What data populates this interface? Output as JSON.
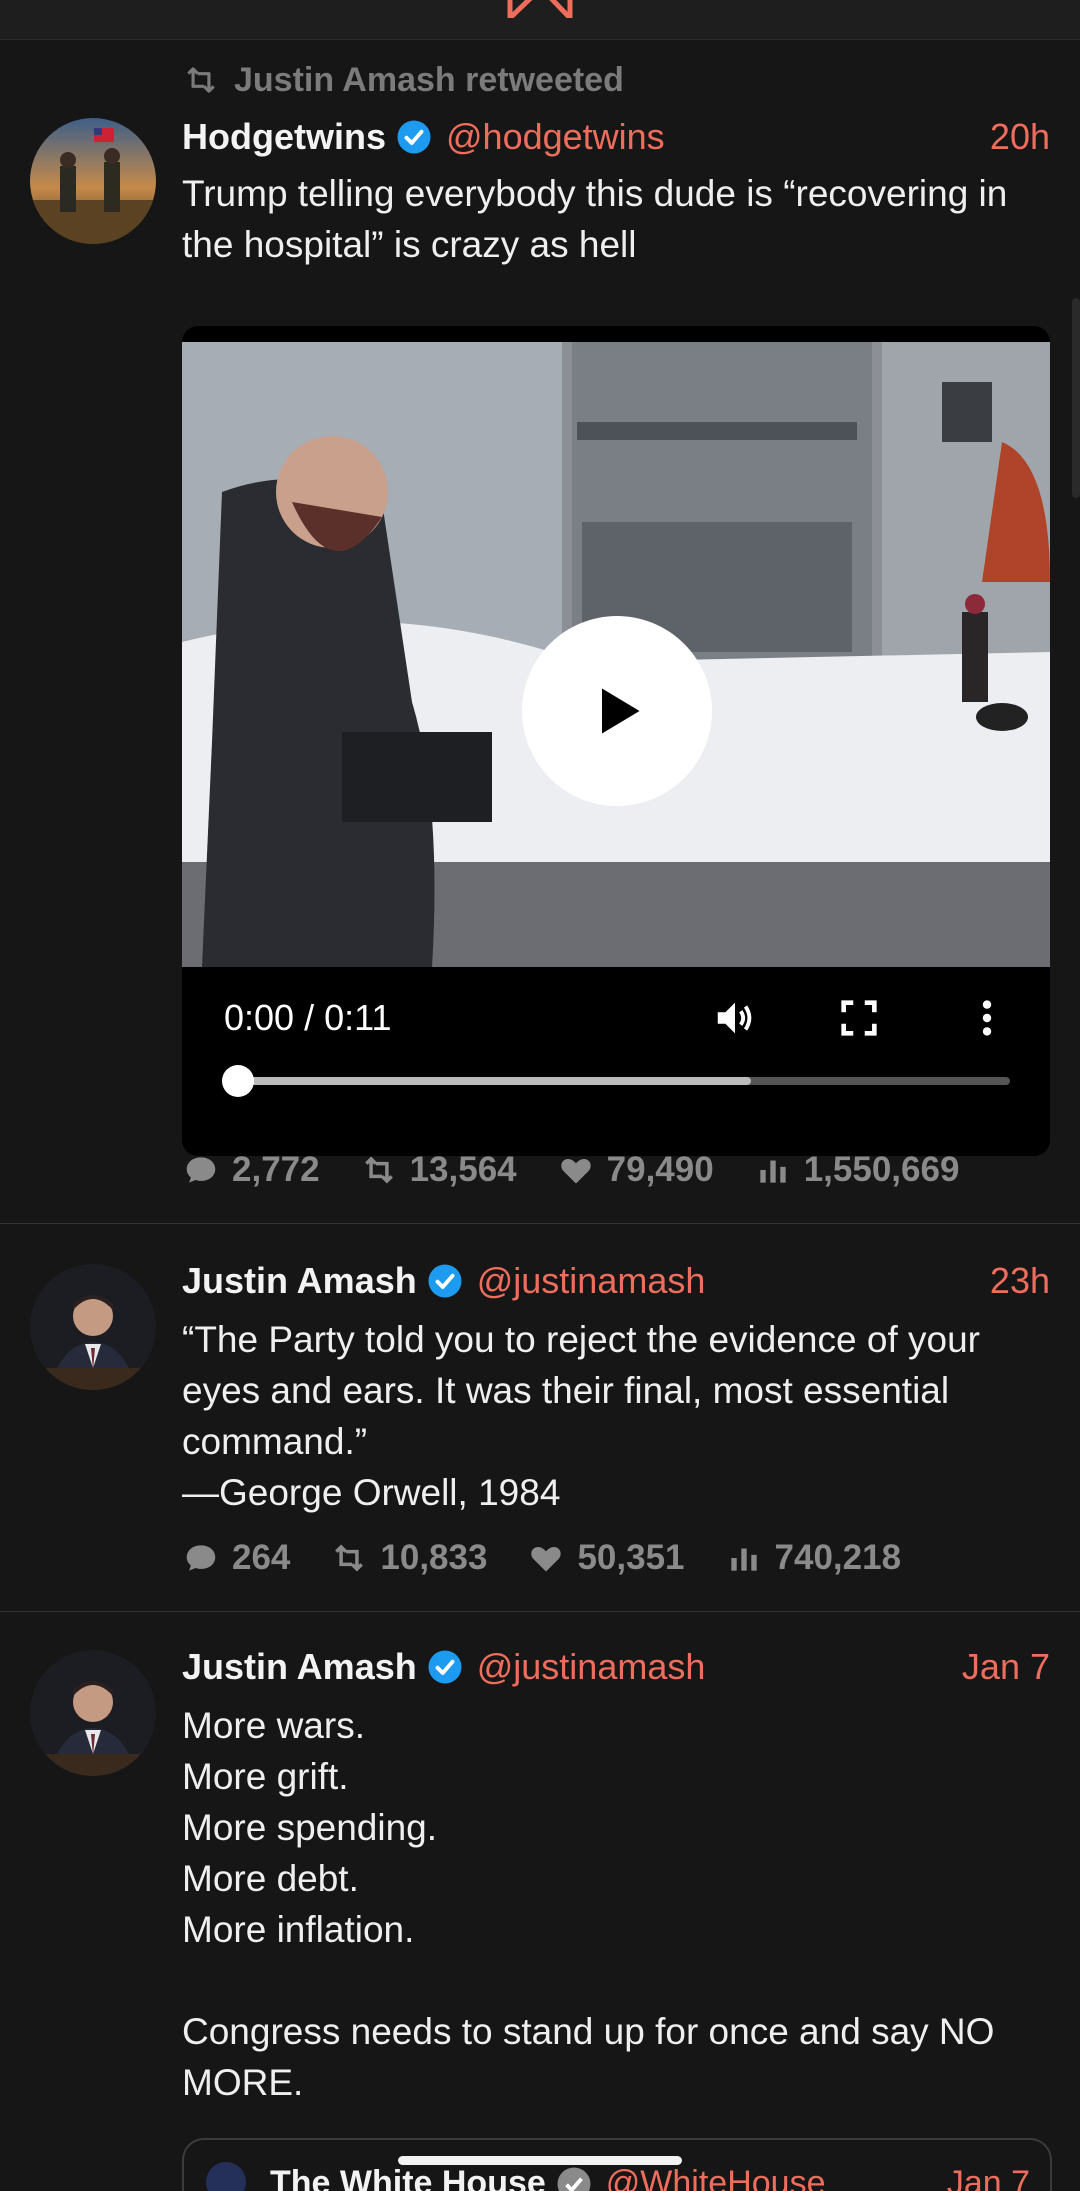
{
  "colors": {
    "accent": "#ef6d5c",
    "background": "#161616",
    "verified": "#1d9bf0"
  },
  "tweets": [
    {
      "retweeted_by": "Justin Amash retweeted",
      "name": "Hodgetwins",
      "handle": "@hodgetwins",
      "time": "20h",
      "text": "Trump telling everybody this dude is “recovering in the hospital” is crazy as hell",
      "video": {
        "time_display": "0:00 / 0:11",
        "buffered_fraction": 0.67,
        "played_fraction": 0.0
      },
      "stats": {
        "replies": "2,772",
        "retweets": "13,564",
        "likes": "79,490",
        "views": "1,550,669"
      }
    },
    {
      "name": "Justin Amash",
      "handle": "@justinamash",
      "time": "23h",
      "text": "“The Party told you to reject the evidence of your eyes and ears. It was their final, most essential command.”\n—George Orwell, 1984",
      "stats": {
        "replies": "264",
        "retweets": "10,833",
        "likes": "50,351",
        "views": "740,218"
      }
    },
    {
      "name": "Justin Amash",
      "handle": "@justinamash",
      "time": "Jan 7",
      "text": "More wars.\nMore grift.\nMore spending.\nMore debt.\nMore inflation.\n\nCongress needs to stand up for once and say NO MORE.",
      "quote": {
        "name": "The White House",
        "handle": "@WhiteHouse",
        "time": "Jan 7"
      }
    }
  ]
}
